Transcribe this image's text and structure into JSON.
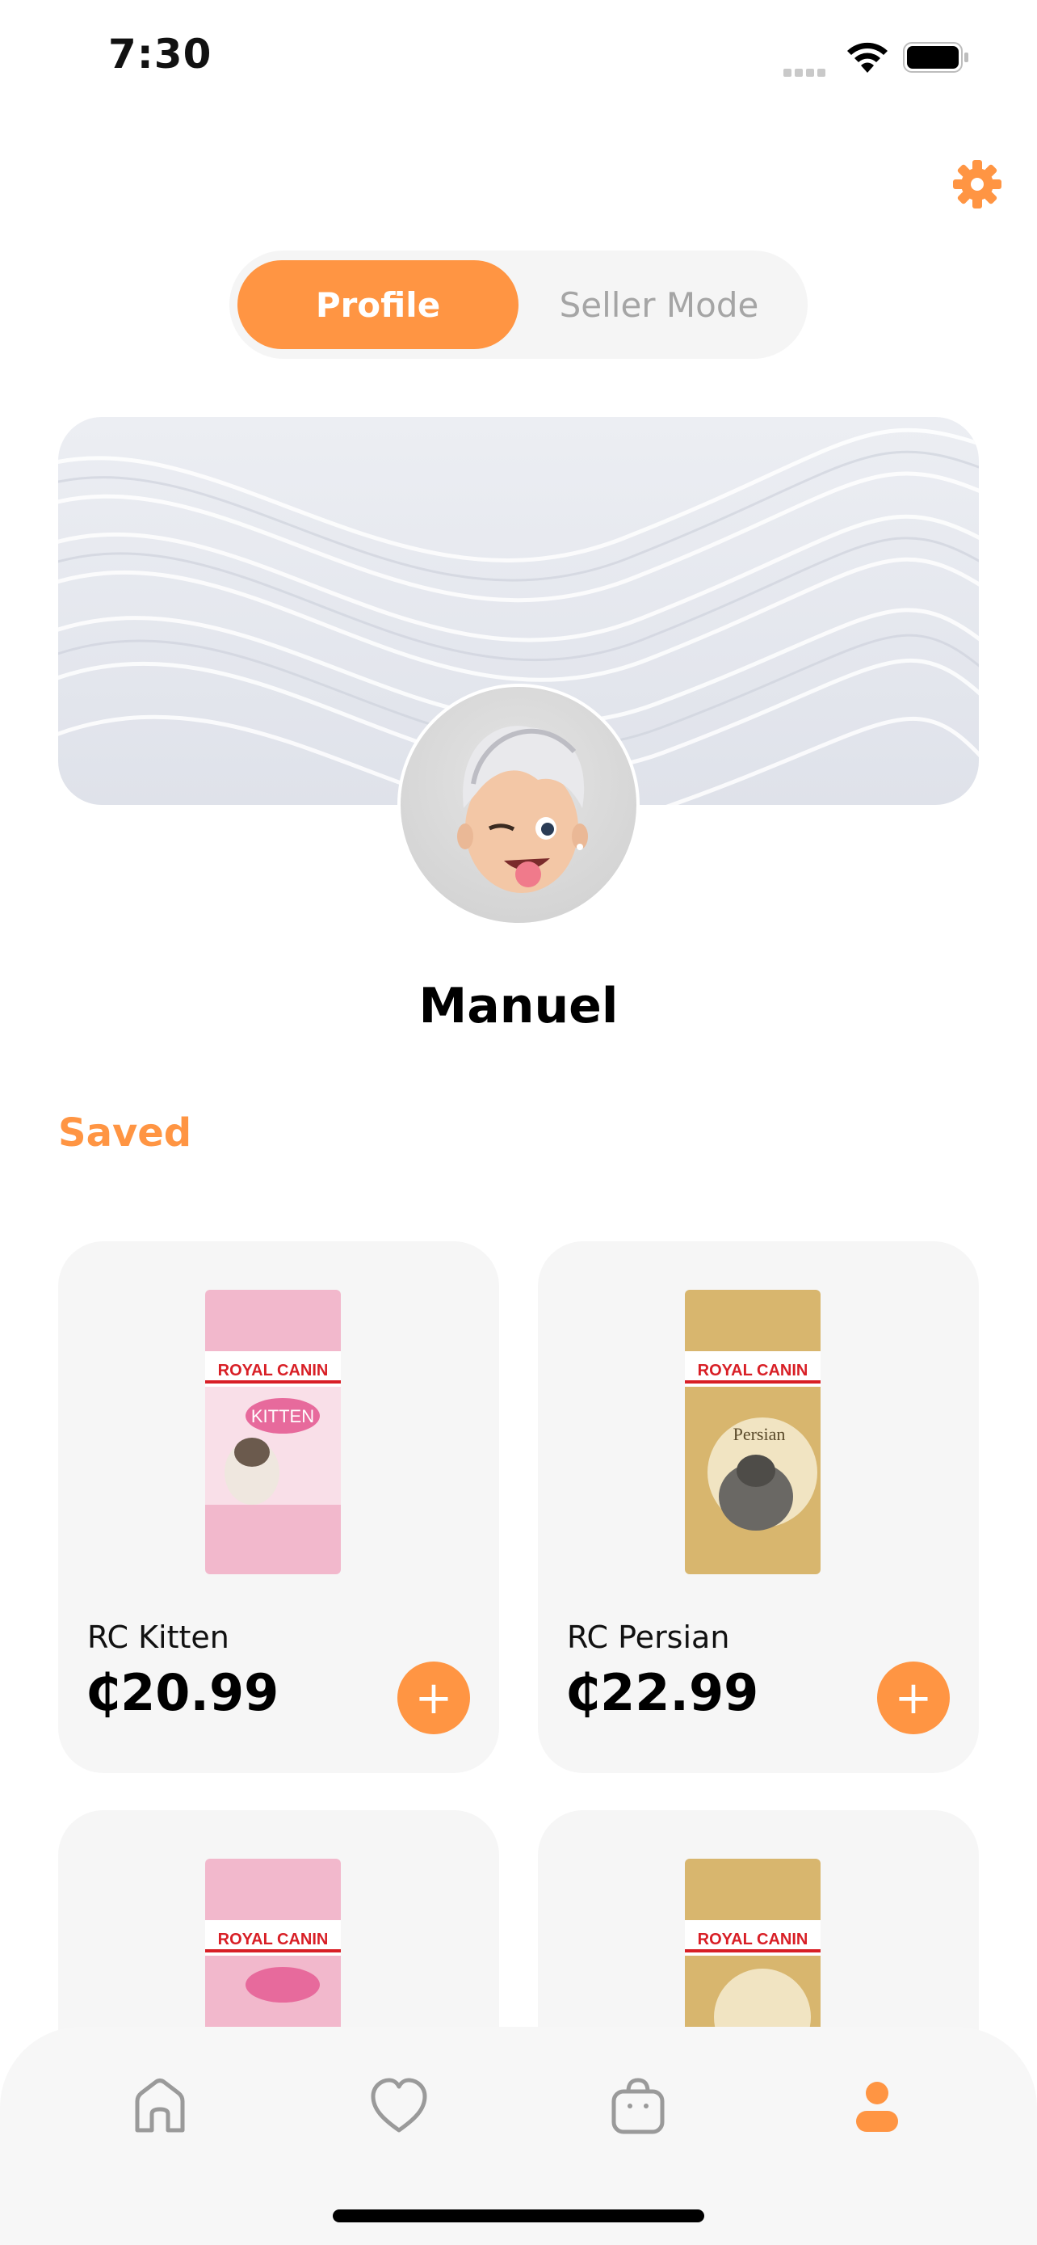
{
  "status_bar": {
    "time": "7:30"
  },
  "segment": {
    "profile_label": "Profile",
    "seller_label": "Seller Mode",
    "active": "Profile"
  },
  "user": {
    "name": "Manuel"
  },
  "saved": {
    "title": "Saved",
    "items": [
      {
        "name": "RC Kitten",
        "price": "₵20.99",
        "add_label": "+",
        "package": "kitten"
      },
      {
        "name": "RC Persian",
        "price": "₵22.99",
        "add_label": "+",
        "package": "persian"
      },
      {
        "name": "",
        "price": "",
        "package": "kitten"
      },
      {
        "name": "",
        "price": "",
        "package": "persian"
      }
    ]
  },
  "package_text": {
    "brand": "ROYAL CANIN",
    "kitten_label": "KITTEN",
    "persian_label": "Persian"
  },
  "nav": {
    "items": [
      "home-icon",
      "heart-icon",
      "bag-icon",
      "profile-icon"
    ],
    "active": "profile-icon"
  },
  "colors": {
    "accent": "#ff9543",
    "card_bg": "#f6f6f6",
    "nav_inactive": "#9a9a9a",
    "kitten_pack": "#f2b8cc",
    "persian_pack": "#d8b66e"
  }
}
